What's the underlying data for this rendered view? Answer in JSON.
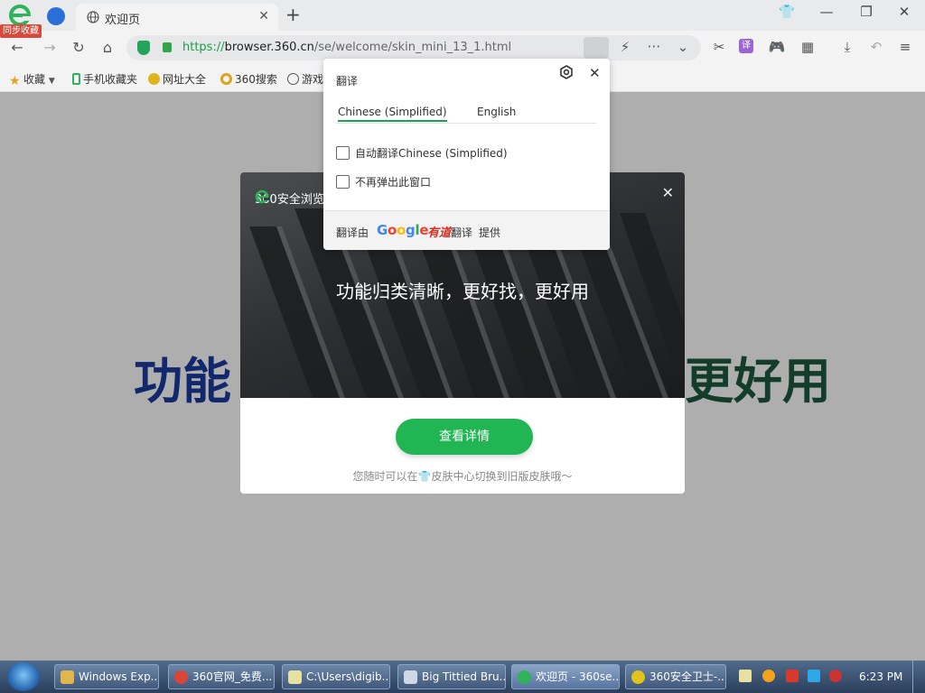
{
  "browser": {
    "sync_badge": "同步收藏",
    "tab_title": "欢迎页",
    "url_scheme": "https://",
    "url_host": "browser.360.cn",
    "url_path": "/se/welcome/skin_mini_13_1.html"
  },
  "bookmarks": [
    {
      "label": "收藏",
      "icon": "star-icon"
    },
    {
      "label": "手机收藏夹",
      "icon": "phone-icon"
    },
    {
      "label": "网址大全",
      "icon": "nav-site-icon"
    },
    {
      "label": "360搜索",
      "icon": "search-360-icon"
    },
    {
      "label": "游戏",
      "icon": "globe-icon"
    }
  ],
  "page": {
    "hero_left": "功能",
    "hero_right": "更好用"
  },
  "skin_modal": {
    "brand": "360安全浏览器",
    "caption": "功能归类清晰，更好找，更好用",
    "button": "查看详情",
    "tip_prefix": "您随时可以在",
    "tip_suffix": "皮肤中心切换到旧版皮肤哦～"
  },
  "translate_popup": {
    "title": "翻译",
    "tab_source": "Chinese (Simplified)",
    "tab_target": "English",
    "opt_auto": "自动翻译Chinese (Simplified)",
    "opt_never": "不再弹出此窗口",
    "footer_prefix": "翻译由",
    "google": "Google",
    "youdao": "有道",
    "footer_mid": "翻译",
    "footer_suffix": "提供"
  },
  "taskbar": {
    "items": [
      {
        "label": "Windows Exp...",
        "icon_color": "#e2b64a"
      },
      {
        "label": "360官网_免费...",
        "icon_color": "#db4437"
      },
      {
        "label": "C:\\Users\\digib...",
        "icon_color": "#e8e0a0"
      },
      {
        "label": "Big Tittied Bru...",
        "icon_color": "#d0d8e4"
      },
      {
        "label": "欢迎页 - 360se...",
        "icon_color": "#2fb35a"
      },
      {
        "label": "360安全卫士-...",
        "icon_color": "#e0c31c"
      }
    ],
    "clock": "6:23 PM"
  },
  "colors": {
    "accent_green": "#22b553",
    "hero_blue": "#12286d",
    "hero_dark_green": "#133d2a"
  }
}
